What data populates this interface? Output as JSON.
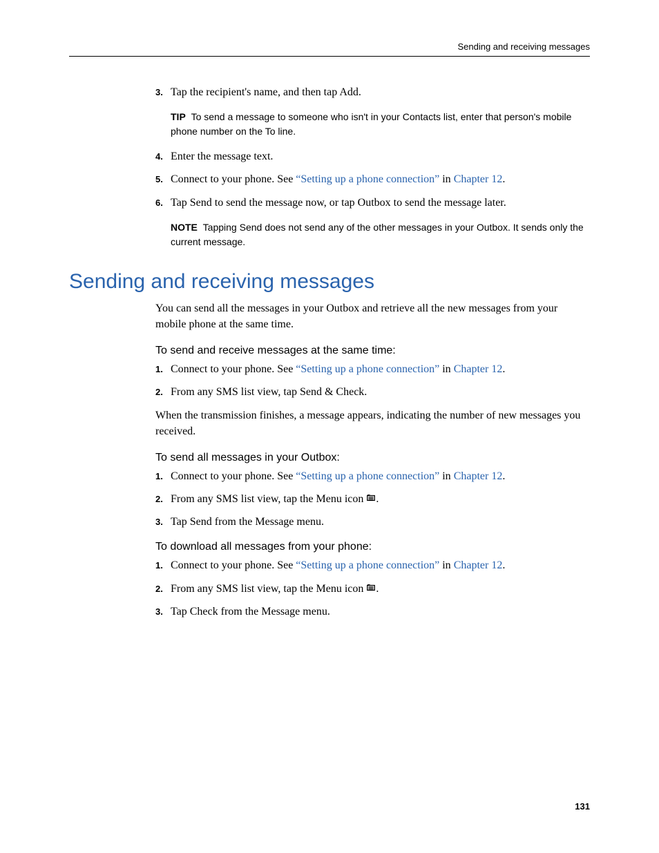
{
  "running_header": "Sending and receiving messages",
  "page_number": "131",
  "top_steps": [
    {
      "n": "3.",
      "text": "Tap the recipient's name, and then tap Add."
    }
  ],
  "tip": {
    "lead": "TIP",
    "text": "To send a message to someone who isn't in your Contacts list, enter that person's mobile phone number on the To line."
  },
  "mid_steps": [
    {
      "n": "4.",
      "text": "Enter the message text."
    },
    {
      "n": "5.",
      "prefix": "Connect to your phone. See ",
      "link1": "“Setting up a phone connection”",
      "mid": " in ",
      "link2": "Chapter 12",
      "suffix": "."
    },
    {
      "n": "6.",
      "text": "Tap Send to send the message now, or tap Outbox to send the message later."
    }
  ],
  "note": {
    "lead": "NOTE",
    "text": "Tapping Send does not send any of the other messages in your Outbox. It sends only the current message."
  },
  "h1": "Sending and receiving messages",
  "intro": "You can send all the messages in your Outbox and retrieve all the new messages from your mobile phone at the same time.",
  "sections": [
    {
      "subhead": "To send and receive messages at the same time:",
      "steps": [
        {
          "n": "1.",
          "prefix": "Connect to your phone. See ",
          "link1": "“Setting up a phone connection”",
          "mid": " in ",
          "link2": "Chapter 12",
          "suffix": "."
        },
        {
          "n": "2.",
          "text": "From any SMS list view, tap Send & Check."
        }
      ],
      "after": "When the transmission finishes, a message appears, indicating the number of new messages you received."
    },
    {
      "subhead": "To send all messages in your Outbox:",
      "steps": [
        {
          "n": "1.",
          "prefix": "Connect to your phone. See ",
          "link1": "“Setting up a phone connection”",
          "mid": " in ",
          "link2": "Chapter 12",
          "suffix": "."
        },
        {
          "n": "2.",
          "preicon": "From any SMS list view, tap the Menu icon ",
          "posticon": "."
        },
        {
          "n": "3.",
          "text": "Tap Send from the Message menu."
        }
      ]
    },
    {
      "subhead": "To download all messages from your phone:",
      "steps": [
        {
          "n": "1.",
          "prefix": "Connect to your phone. See ",
          "link1": "“Setting up a phone connection”",
          "mid": " in ",
          "link2": "Chapter 12",
          "suffix": "."
        },
        {
          "n": "2.",
          "preicon": "From any SMS list view, tap the Menu icon ",
          "posticon": "."
        },
        {
          "n": "3.",
          "text": "Tap Check from the Message menu."
        }
      ]
    }
  ]
}
